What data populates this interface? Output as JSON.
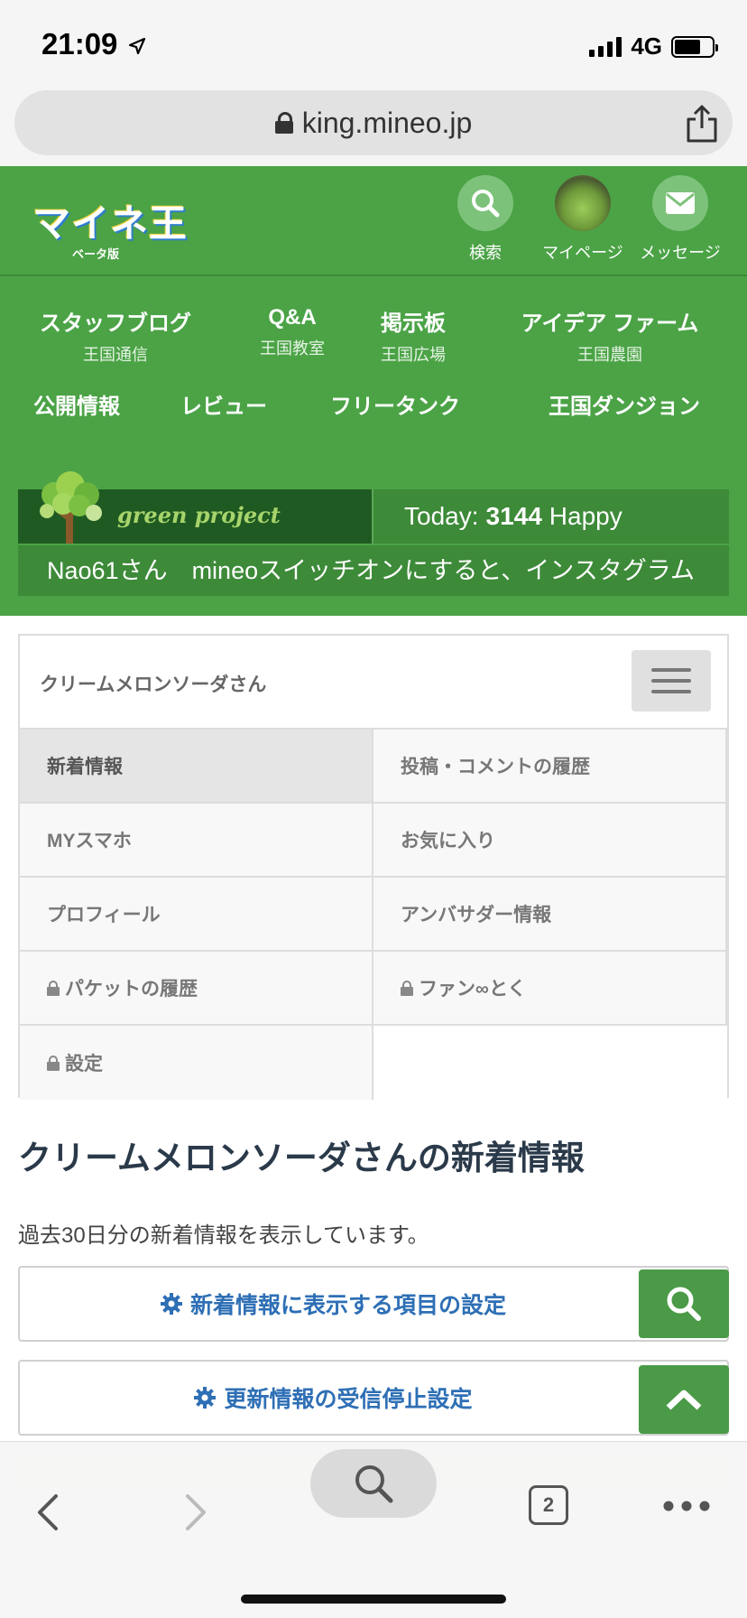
{
  "status_bar": {
    "time": "21:09",
    "network": "4G"
  },
  "browser": {
    "url": "king.mineo.jp"
  },
  "header": {
    "logo_main": "マイネ王",
    "logo_sub": "ベータ版",
    "search_label": "検索",
    "mypage_label": "マイページ",
    "message_label": "メッセージ"
  },
  "nav": {
    "items": [
      {
        "label": "スタッフブログ",
        "sub": "王国通信"
      },
      {
        "label": "Q&A",
        "sub": "王国教室"
      },
      {
        "label": "掲示板",
        "sub": "王国広場"
      },
      {
        "label": "アイデア ファーム",
        "sub": "王国農園"
      },
      {
        "label": "公開情報"
      },
      {
        "label": "レビュー"
      },
      {
        "label": "フリータンク"
      },
      {
        "label": "王国ダンジョン"
      }
    ]
  },
  "banner": {
    "project_name": "green project",
    "today_prefix": "Today:",
    "today_count": "3144",
    "today_suffix": "Happy",
    "ticker_text": "Nao61さん　mineoスイッチオンにすると、インスタグラム"
  },
  "mypage_menu": {
    "username": "クリームメロンソーダさん",
    "items": [
      {
        "label": "新着情報"
      },
      {
        "label": "投稿・コメントの履歴"
      },
      {
        "label": "MYスマホ"
      },
      {
        "label": "お気に入り"
      },
      {
        "label": "プロフィール"
      },
      {
        "label": "アンバサダー情報"
      },
      {
        "label": "パケットの履歴"
      },
      {
        "label": "ファン∞とく"
      },
      {
        "label": "設定"
      }
    ]
  },
  "content": {
    "title": "クリームメロンソーダさんの新着情報",
    "description": "過去30日分の新着情報を表示しています。",
    "settings_button": "新着情報に表示する項目の設定",
    "unsubscribe_button": "更新情報の受信停止設定"
  },
  "toolbar": {
    "tab_count": "2"
  },
  "colors": {
    "brand_green": "#4ba346",
    "link_blue": "#2e6fb5"
  }
}
